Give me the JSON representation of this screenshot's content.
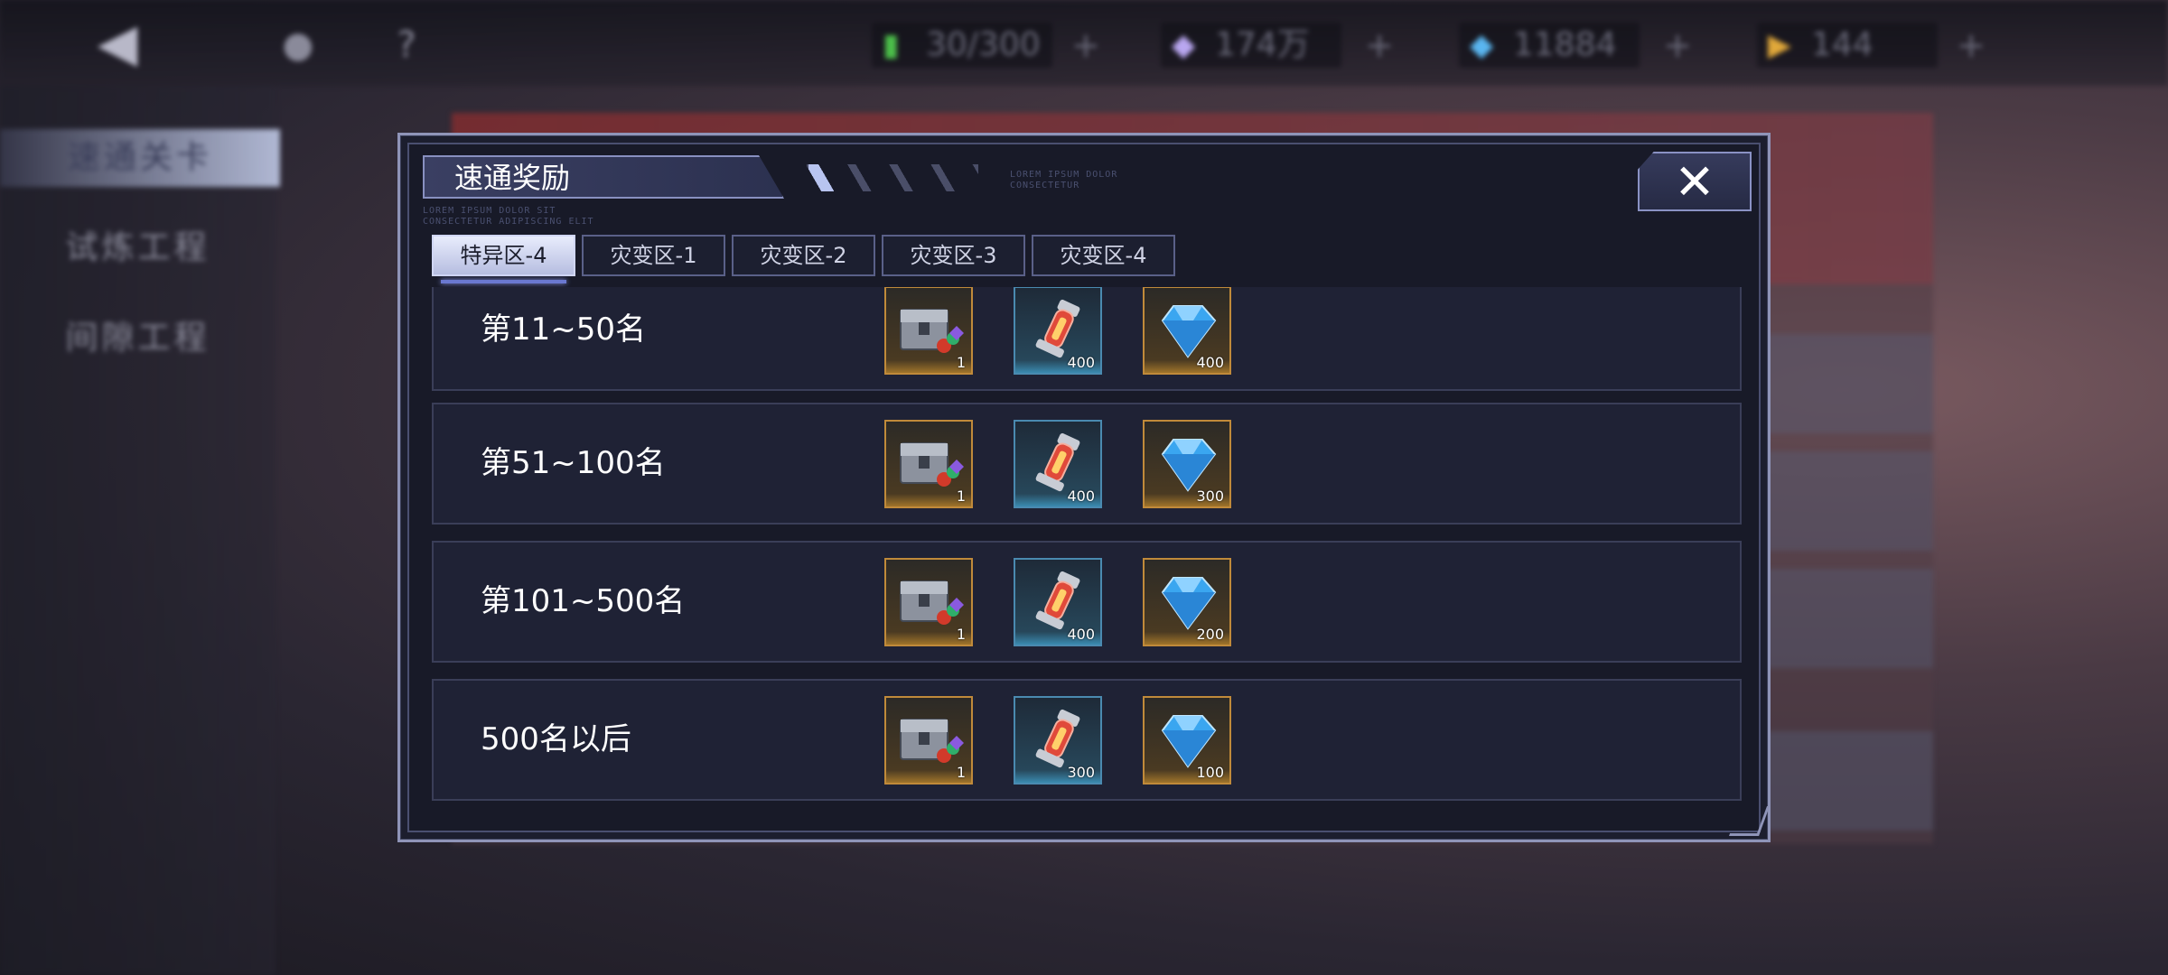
{
  "topbar": {
    "back_glyph": "◀",
    "icons": [
      {
        "name": "home-icon",
        "glyph": "●"
      },
      {
        "name": "help-icon",
        "glyph": "?"
      }
    ],
    "resources": [
      {
        "name": "stamina",
        "icon": "stamina-icon",
        "glyph": "▮",
        "color": "#4cbf4a",
        "value": "30/300"
      },
      {
        "name": "gold",
        "icon": "gem-icon",
        "glyph": "◆",
        "color": "#b9a7f0",
        "value": "174万"
      },
      {
        "name": "crystal",
        "icon": "crystal-icon",
        "glyph": "◆",
        "color": "#5ab6f0",
        "value": "11884"
      },
      {
        "name": "ticket",
        "icon": "ticket-icon",
        "glyph": "▶",
        "color": "#e0a83a",
        "value": "144"
      }
    ],
    "plus": "+"
  },
  "sidebar": {
    "items": [
      {
        "label": "速通关卡",
        "active": true
      },
      {
        "label": "试炼工程"
      },
      {
        "label": "间隙工程"
      }
    ]
  },
  "modal": {
    "title": "速通奖励",
    "deco_lines": [
      "LOREM IPSUM DOLOR SIT",
      "CONSECTETUR ADIPISCING ELIT"
    ],
    "deco_right": [
      "LOREM IPSUM DOLOR",
      "CONSECTETUR"
    ],
    "close_glyph": "✕",
    "tabs": [
      {
        "label": "特异区-4",
        "active": true
      },
      {
        "label": "灾变区-1"
      },
      {
        "label": "灾变区-2"
      },
      {
        "label": "灾变区-3"
      },
      {
        "label": "灾变区-4"
      }
    ],
    "rows": [
      {
        "label": "第11~50名",
        "rewards": [
          {
            "item": "supply-chest",
            "frame": "gold",
            "qty": "1"
          },
          {
            "item": "energy-capsule",
            "frame": "blue",
            "qty": "400"
          },
          {
            "item": "diamond",
            "frame": "gold",
            "qty": "400"
          }
        ]
      },
      {
        "label": "第51~100名",
        "rewards": [
          {
            "item": "supply-chest",
            "frame": "gold",
            "qty": "1"
          },
          {
            "item": "energy-capsule",
            "frame": "blue",
            "qty": "400"
          },
          {
            "item": "diamond",
            "frame": "gold",
            "qty": "300"
          }
        ]
      },
      {
        "label": "第101~500名",
        "rewards": [
          {
            "item": "supply-chest",
            "frame": "gold",
            "qty": "1"
          },
          {
            "item": "energy-capsule",
            "frame": "blue",
            "qty": "400"
          },
          {
            "item": "diamond",
            "frame": "gold",
            "qty": "200"
          }
        ]
      },
      {
        "label": "500名以后",
        "rewards": [
          {
            "item": "supply-chest",
            "frame": "gold",
            "qty": "1"
          },
          {
            "item": "energy-capsule",
            "frame": "blue",
            "qty": "300"
          },
          {
            "item": "diamond",
            "frame": "gold",
            "qty": "100"
          }
        ]
      }
    ]
  }
}
